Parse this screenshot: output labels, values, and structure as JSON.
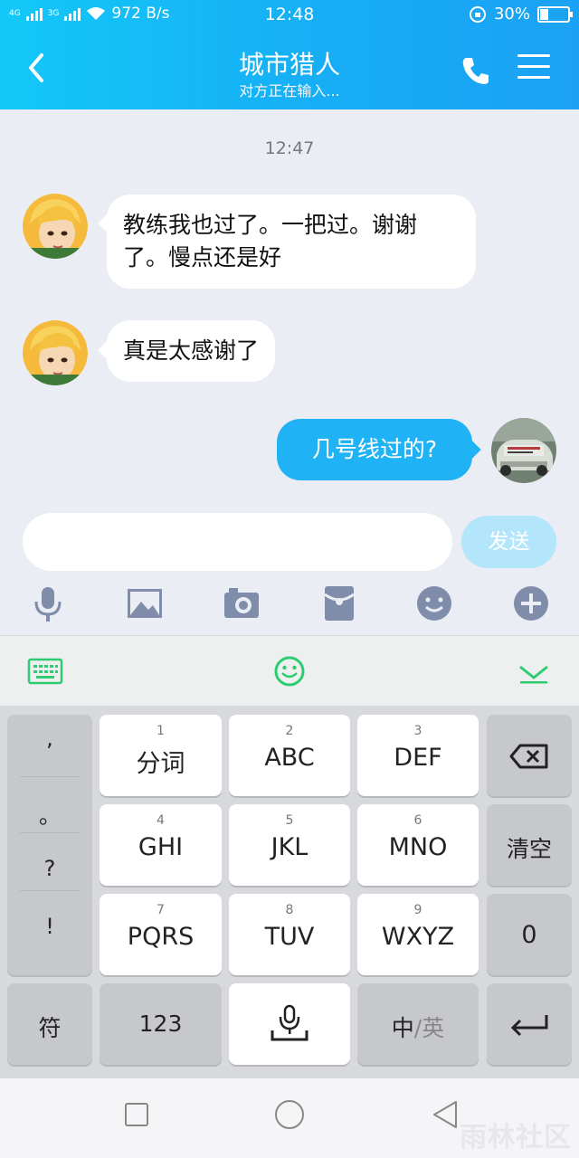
{
  "status_bar": {
    "network_left": "4G",
    "network_right": "3G",
    "speed": "972 B/s",
    "time": "12:48",
    "battery": "30%",
    "battery_level": 0.3
  },
  "header": {
    "title": "城市猎人",
    "subtitle": "对方正在输入..."
  },
  "chat": {
    "timestamp": "12:47",
    "messages": [
      {
        "from": "contact",
        "text": "教练我也过了。一把过。谢谢了。慢点还是好"
      },
      {
        "from": "contact",
        "text": "真是太感谢了"
      },
      {
        "from": "me",
        "text": "几号线过的?"
      }
    ]
  },
  "composer": {
    "placeholder": "",
    "send_label": "发送",
    "tools": [
      "mic-icon",
      "image-icon",
      "camera-icon",
      "red-packet-icon",
      "emoji-icon",
      "plus-icon"
    ]
  },
  "keyboard": {
    "symbols": [
      ",",
      "。",
      "?",
      "!"
    ],
    "keys": [
      {
        "num": "1",
        "label": "分词"
      },
      {
        "num": "2",
        "label": "ABC"
      },
      {
        "num": "3",
        "label": "DEF"
      },
      {
        "num": "4",
        "label": "GHI"
      },
      {
        "num": "5",
        "label": "JKL"
      },
      {
        "num": "6",
        "label": "MNO"
      },
      {
        "num": "7",
        "label": "PQRS"
      },
      {
        "num": "8",
        "label": "TUV"
      },
      {
        "num": "9",
        "label": "WXYZ"
      }
    ],
    "clear_label": "清空",
    "zero_label": "0",
    "fu_label": "符",
    "num123_label": "123",
    "lang_label_cn": "中",
    "lang_label_sep": "/",
    "lang_label_en": "英"
  },
  "colors": {
    "header_start": "#13c8f8",
    "header_end": "#1ba1f3",
    "bubble_out": "#1fb3f5",
    "keyboard_accent": "#2ecc71"
  }
}
